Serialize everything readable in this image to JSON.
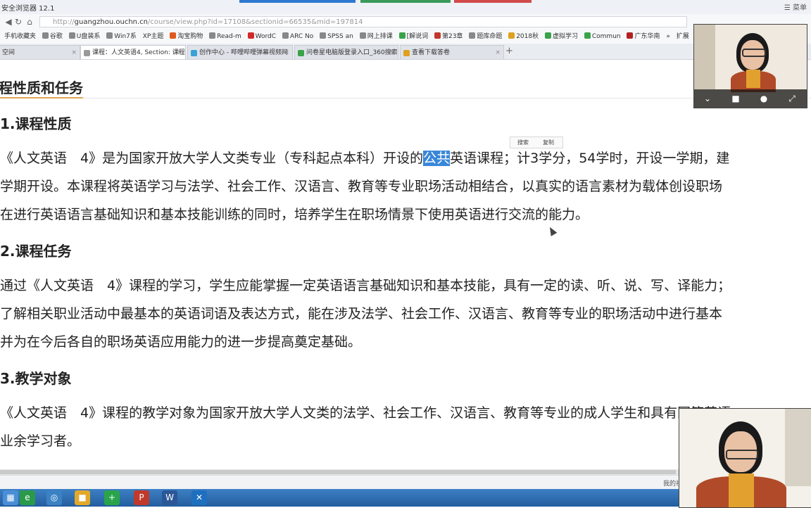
{
  "browser": {
    "app_title": "安全浏览器 12.1",
    "right_label": "菜单",
    "address": {
      "prefix": "http://",
      "host": "guangzhou.ouchn.cn",
      "path": "/course/view.php?id=17108&sectionid=66535&mid=197814"
    },
    "bookmarks": [
      "手机收藏夹",
      "谷歌",
      "U盘装系",
      "Win7系",
      "XP主题",
      "淘宝购物",
      "Read-m",
      "WordC",
      "ARC No",
      "SPSS an",
      "网上排课",
      "[解说词",
      "第23章",
      "题库命题",
      "2018秋",
      "虚拟学习",
      "Commun",
      "广东华南",
      "»",
      "扩展"
    ],
    "tabs": [
      {
        "label": "空间",
        "active": false
      },
      {
        "label": "课程：人文英语4, Section: 课程",
        "active": true
      },
      {
        "label": "创作中心 - 哔哩哔哩弹幕视频网",
        "active": false
      },
      {
        "label": "问卷星电脑版登录入口_360搜索",
        "active": false
      },
      {
        "label": "查看下载答卷",
        "active": false
      }
    ]
  },
  "page": {
    "section_title": "课程性质和任务",
    "nature_heading": "1.课程性质",
    "nature_lines": {
      "line1_before": "《人文英语　4》是为国家开放大学人文类专业（专科起点本科）开设的",
      "line1_highlight": "公共",
      "line1_after": "英语课程；计3学分，54学时，开设一学期，建",
      "line2": "学期开设。本课程将英语学习与法学、社会工作、汉语言、教育等专业职场活动相结合，以真实的语言素材为载体创设职场",
      "line3": "在进行英语语言基础知识和基本技能训练的同时，培养学生在职场情景下使用英语进行交流的能力。"
    },
    "task_heading": "2.课程任务",
    "task_lines": [
      "通过《人文英语　4》课程的学习，学生应能掌握一定英语语言基础知识和基本技能，具有一定的读、听、说、写、译能力；",
      "了解相关职业活动中最基本的英语词语及表达方式，能在涉及法学、社会工作、汉语言、教育等专业的职场活动中进行基本",
      "并为在今后各自的职场英语应用能力的进一步提高奠定基础。"
    ],
    "target_heading": "3.教学对象",
    "target_lines": [
      "《人文英语　4》课程的教学对象为国家开放大学人文类的法学、社会工作、汉语言、教育等专业的成人学生和具有同等英语",
      "业余学习者。"
    ],
    "selection_popup": {
      "search": "搜索",
      "copy": "复制"
    }
  },
  "statusbar": {
    "text": "我的视"
  },
  "icons": {
    "back": "back-arrow-icon",
    "forward": "forward-arrow-icon",
    "refresh": "refresh-icon",
    "home": "home-icon",
    "video_collapse": "chevron-down-icon",
    "camera": "camera-icon",
    "mic": "microphone-icon",
    "fullscreen": "fullscreen-icon"
  },
  "colors": {
    "accent_underline": "#e0a55a",
    "highlight": "#3a87d8",
    "taskbar": "#2b6cb0"
  }
}
